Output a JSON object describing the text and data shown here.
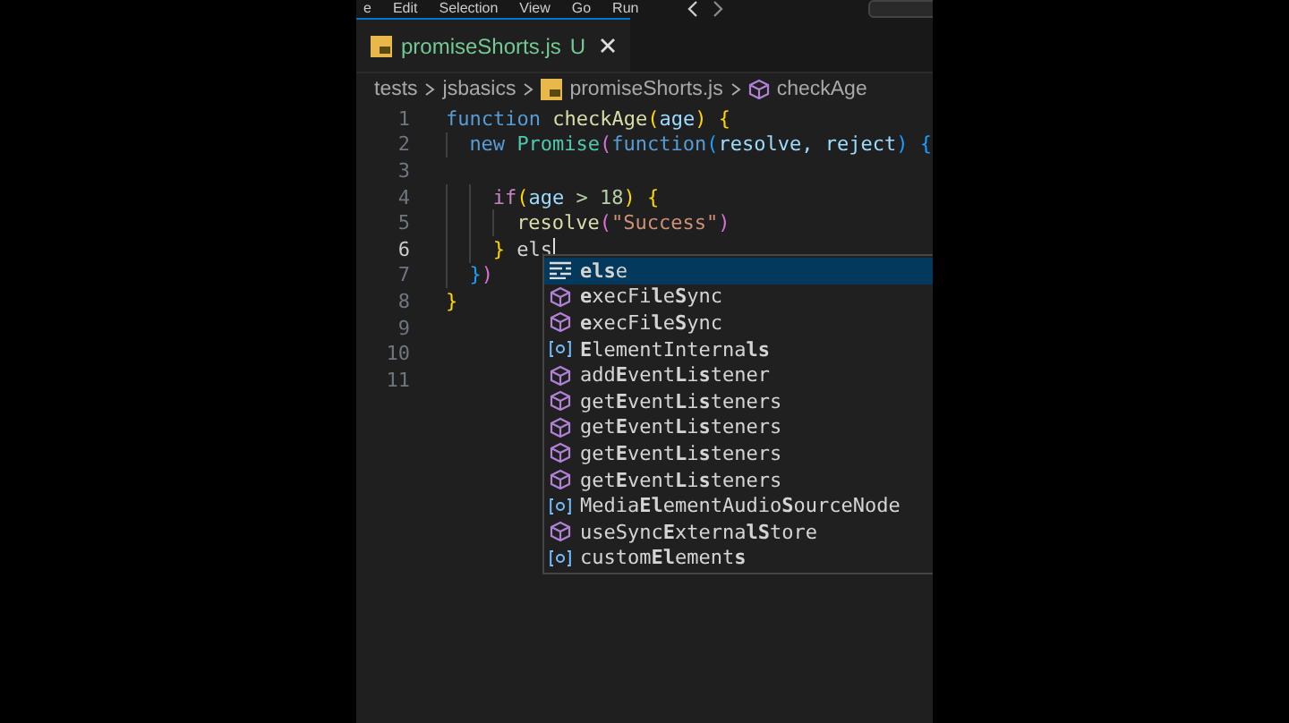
{
  "menu_bar": {
    "items": [
      "e",
      "Edit",
      "Selection",
      "View",
      "Go",
      "Run"
    ]
  },
  "tabs": [
    {
      "label": "promiseShorts.js",
      "status": "U",
      "selected": true
    }
  ],
  "breadcrumbs": [
    {
      "label": "tests",
      "kind": "folder"
    },
    {
      "label": "jsbasics",
      "kind": "folder"
    },
    {
      "label": "promiseShorts.js",
      "kind": "file"
    },
    {
      "label": "checkAge",
      "kind": "function"
    }
  ],
  "code_lines": [
    {
      "number": "1",
      "tokens": [
        {
          "t": "function ",
          "kind": "keyword"
        },
        {
          "t": "checkAge",
          "kind": "function"
        },
        {
          "t": "(",
          "kind": "bracket"
        },
        {
          "t": "age",
          "kind": "param"
        },
        {
          "t": ") ",
          "kind": "bracket"
        },
        {
          "t": "{",
          "kind": "bracket"
        }
      ]
    },
    {
      "number": "2",
      "tokens": [
        {
          "t": "  new ",
          "kind": "keyword"
        },
        {
          "t": "Promise",
          "kind": "type"
        },
        {
          "t": "(",
          "kind": "bracket2"
        },
        {
          "t": "function",
          "kind": "keyword"
        },
        {
          "t": "(",
          "kind": "bracket3"
        },
        {
          "t": "resolve",
          "kind": "param"
        },
        {
          "t": ", reject",
          "kind": "param"
        },
        {
          "t": ") {",
          "kind": "bracket3"
        }
      ]
    },
    {
      "number": "3"
    },
    {
      "number": "4",
      "tokens": [
        {
          "t": "    if",
          "kind": "control"
        },
        {
          "t": "(",
          "kind": "bracket"
        },
        {
          "t": "age",
          "kind": "param"
        },
        {
          "t": " > 18",
          "kind": "number"
        },
        {
          "t": ") {",
          "kind": "bracket"
        }
      ]
    },
    {
      "number": "5",
      "tokens": [
        {
          "t": "      resolve",
          "kind": "function"
        },
        {
          "t": "(",
          "kind": "bracket2"
        },
        {
          "t": "\"Success\"",
          "kind": "string"
        },
        {
          "t": ")",
          "kind": "bracket2"
        }
      ]
    },
    {
      "number": "6",
      "cursor": true,
      "tokens": [
        {
          "t": "    }",
          "kind": "bracket"
        },
        {
          "t": " els",
          "kind": "plain"
        }
      ]
    },
    {
      "number": "7",
      "tokens": [
        {
          "t": "  }",
          "kind": "bracket3"
        },
        {
          "t": ")",
          "kind": "bracket2"
        }
      ]
    },
    {
      "number": "8",
      "tokens": [
        {
          "t": "}",
          "kind": "bracket"
        }
      ]
    },
    {
      "number": "9"
    },
    {
      "number": "10"
    },
    {
      "number": "11"
    }
  ],
  "suggestions": [
    {
      "label": "**els**e",
      "kind": "keyword",
      "selected": true
    },
    {
      "label": "**e**xecFi**l**e**S**ync",
      "kind": "method",
      "selected": false
    },
    {
      "label": "**e**xecFi**l**e**S**ync",
      "kind": "method",
      "selected": false
    },
    {
      "label": "**E**lementInterna**ls**",
      "kind": "variable",
      "selected": false
    },
    {
      "label": "add**E**vent**L**i**s**tener",
      "kind": "method",
      "selected": false
    },
    {
      "label": "get**E**vent**L**i**s**teners",
      "kind": "method",
      "selected": false
    },
    {
      "label": "get**E**vent**L**i**s**teners",
      "kind": "method",
      "selected": false
    },
    {
      "label": "get**E**vent**L**i**s**teners",
      "kind": "method",
      "selected": false
    },
    {
      "label": "get**E**vent**L**i**s**teners",
      "kind": "method",
      "selected": false
    },
    {
      "label": "Media**El**ementAudio**S**ourceNode",
      "kind": "variable",
      "selected": false
    },
    {
      "label": "useSync**E**xterna**lS**tore",
      "kind": "method",
      "selected": false
    },
    {
      "label": "custom**El**ement**s**",
      "kind": "variable",
      "selected": false
    }
  ]
}
